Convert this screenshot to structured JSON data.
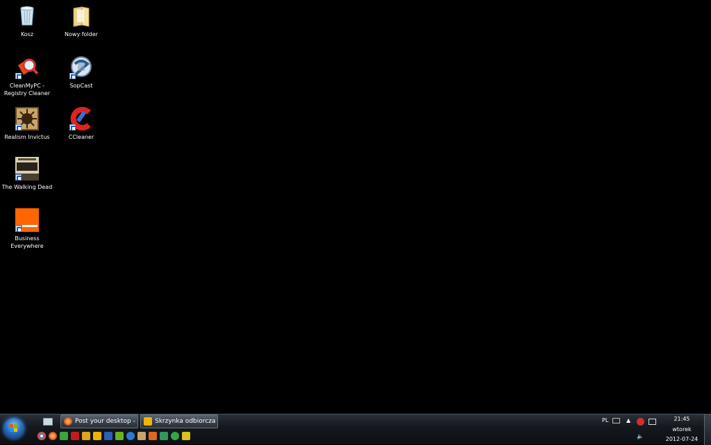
{
  "desktop": {
    "icons": [
      {
        "label": "Kosz",
        "icon": "recycle-bin-icon"
      },
      {
        "label": "Nowy folder",
        "icon": "folder-icon"
      },
      {
        "label": "CleanMyPC - Registry Cleaner",
        "icon": "cleanmypc-icon"
      },
      {
        "label": "SopCast",
        "icon": "sopcast-icon"
      },
      {
        "label": "Realism Invictus",
        "icon": "realism-invictus-icon"
      },
      {
        "label": "CCleaner",
        "icon": "ccleaner-icon"
      },
      {
        "label": "The Walking Dead",
        "icon": "walking-dead-icon"
      },
      {
        "label": "Business Everywhere",
        "icon": "orange-business-icon"
      }
    ]
  },
  "taskbar": {
    "start_icon": "windows-start-orb",
    "windows": [
      {
        "label": "Post your desktop - ...",
        "icon": "firefox-icon"
      },
      {
        "label": "Skrzynka odbiorcza ...",
        "icon": "outlook-icon"
      }
    ],
    "quick_launch_icons": [
      "chrome-icon",
      "firefox-icon",
      "green-app-icon",
      "red-app-icon",
      "lightning-app-icon",
      "outlook-icon",
      "word-icon",
      "notepad-icon",
      "blue-circle-icon",
      "realism-icon",
      "orange-icon",
      "green-cube-icon",
      "green-circle-icon",
      "yellow-app-icon"
    ],
    "tray": {
      "language": "PL",
      "time": "21:45",
      "day": "wtorek",
      "date": "2012-07-24"
    },
    "colors": {
      "accent": "#2a6fc2"
    }
  }
}
